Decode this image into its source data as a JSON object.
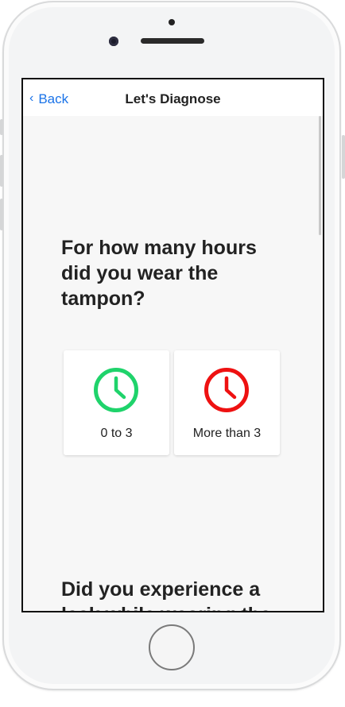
{
  "navbar": {
    "back_label": "Back",
    "title": "Let's Diagnose"
  },
  "questions": [
    {
      "text": "For how many hours did you wear the tampon?",
      "options": [
        {
          "label": "0 to 3",
          "icon": "clock-icon",
          "color": "#1fd36b"
        },
        {
          "label": "More than 3",
          "icon": "clock-icon",
          "color": "#ee1111"
        }
      ]
    },
    {
      "text": "Did you experience a leak while wearing the"
    }
  ],
  "colors": {
    "accent": "#1a73e8",
    "screen_background": "#f7f7f7"
  }
}
